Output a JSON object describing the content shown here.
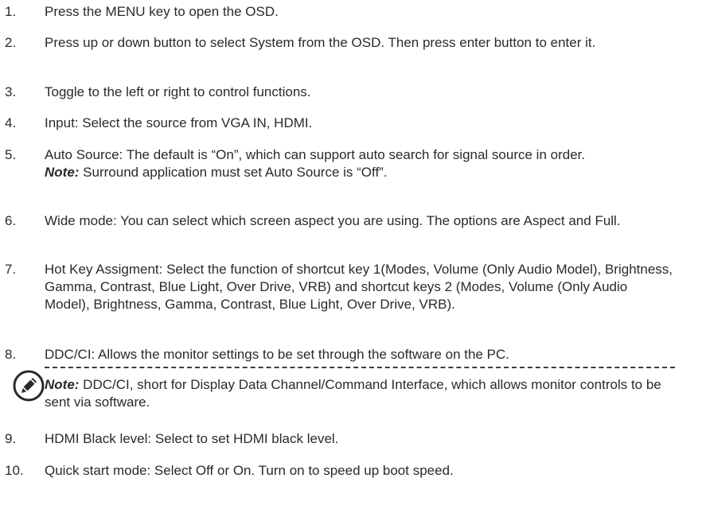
{
  "steps": [
    {
      "num": "1.",
      "text": "Press the MENU key to open the OSD."
    },
    {
      "num": "2.",
      "text": "Press up or down button to select System from the OSD. Then press enter button to enter it."
    },
    {
      "num": "3.",
      "text": "Toggle to the left or right to control functions."
    },
    {
      "num": "4.",
      "text": "Input: Select the source from VGA IN, HDMI."
    },
    {
      "num": "5.",
      "text": "Auto Source: The default is “On”, which can support auto search for signal source in order.",
      "note_label": "Note:",
      "note_text": " Surround application must set Auto Source is “Off”."
    },
    {
      "num": "6.",
      "text": "Wide mode: You can select which screen aspect you are using. The options are Aspect and Full."
    },
    {
      "num": "7.",
      "text": "Hot Key Assigment: Select the function of shortcut key 1(Modes, Volume (Only Audio Model), Brightness,  Gamma, Contrast, Blue Light, Over Drive, VRB) and shortcut keys 2 (Modes, Volume (Only Audio Model), Brightness, Gamma, Contrast, Blue Light, Over Drive, VRB)."
    },
    {
      "num": "8.",
      "text": "DDC/CI: Allows the monitor settings to be set through the software on the PC.",
      "note_label": "Note:",
      "note_text": " DDC/CI, short for Display Data Channel/Command Interface, which allows monitor controls to be sent via software."
    },
    {
      "num": "9.",
      "text": "HDMI Black level: Select to set HDMI black level."
    },
    {
      "num": "10.",
      "text": "Quick start mode: Select Off or On. Turn on to speed up boot speed."
    }
  ],
  "icons": {
    "note": "note-pencil-icon"
  }
}
